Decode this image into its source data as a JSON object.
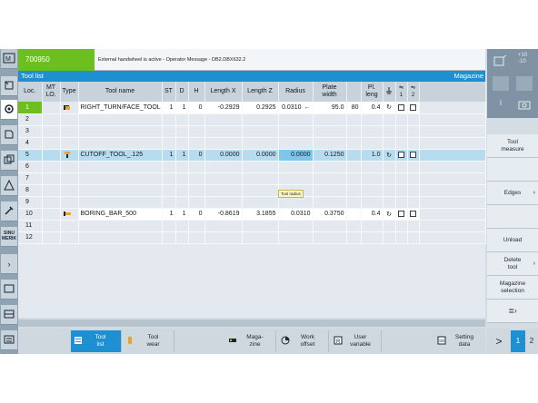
{
  "header": {
    "program": "700950",
    "message": "External handwheel is active - Operator Message -  DB2.DBX632.2"
  },
  "titlebar": {
    "left": "Tool list",
    "right": "Magazine"
  },
  "columns": {
    "loc": "Loc.",
    "mt": "MT\nLO.",
    "type": "Type",
    "name": "Tool name",
    "st": "ST",
    "d": "D",
    "h": "H",
    "lx": "Length X",
    "lz": "Length Z",
    "radius": "Radius",
    "plate": "Plate\nwidth",
    "pl": "Pl.\nleng",
    "spindle_icon": "spindle-icon",
    "c1": "1",
    "c2": "2"
  },
  "rows": [
    {
      "loc": "1",
      "type_icon": "turning-tool-icon",
      "name": "RIGHT_TURN/FACE_TOOL",
      "st": "1",
      "d": "1",
      "h": "0",
      "lx": "-0.2929",
      "lz": "0.2925",
      "radius": "0.0310",
      "dir": "←",
      "plate": "95.0",
      "angle": "80",
      "pl": "0.4"
    },
    {
      "loc": "2"
    },
    {
      "loc": "3"
    },
    {
      "loc": "4"
    },
    {
      "loc": "5",
      "type_icon": "cutoff-tool-icon",
      "name": "CUTOFF_TOOL_.125",
      "st": "1",
      "d": "1",
      "h": "0",
      "lx": "0.0000",
      "lz": "0.0000",
      "radius": "0.0000",
      "dir": "",
      "plate": "0.1250",
      "angle": "",
      "pl": "1.0"
    },
    {
      "loc": "6"
    },
    {
      "loc": "7"
    },
    {
      "loc": "8"
    },
    {
      "loc": "9"
    },
    {
      "loc": "10",
      "type_icon": "boring-bar-icon",
      "name": "BORING_BAR_500",
      "st": "1",
      "d": "1",
      "h": "0",
      "lx": "-0.8619",
      "lz": "3.1855",
      "radius": "0.0310",
      "dir": "",
      "plate": "0.3750",
      "angle": "",
      "pl": "0.4"
    },
    {
      "loc": "11"
    },
    {
      "loc": "12"
    }
  ],
  "tooltip": "Tool radius",
  "leftbar": {
    "sinumerik": "SINU\nMERIK"
  },
  "bottom_softkeys": [
    {
      "label": "Tool\nlist",
      "active": true
    },
    {
      "label": "Tool\nwear"
    },
    {
      "label": "Maga-\nzine"
    },
    {
      "label": "Work\noffset"
    },
    {
      "label": "User\nvariable"
    },
    {
      "label": "Setting\ndata"
    }
  ],
  "right_softkeys": [
    "Tool\nmeasure",
    "Edges",
    "Unload",
    "Delete\ntool",
    "Magazine\nselection"
  ],
  "pager": {
    "next": ">",
    "page1": "1",
    "page2": "2"
  },
  "colors": {
    "accent": "#1e8fd0",
    "program_green": "#6cbf1f",
    "selection": "#b7dcef"
  }
}
